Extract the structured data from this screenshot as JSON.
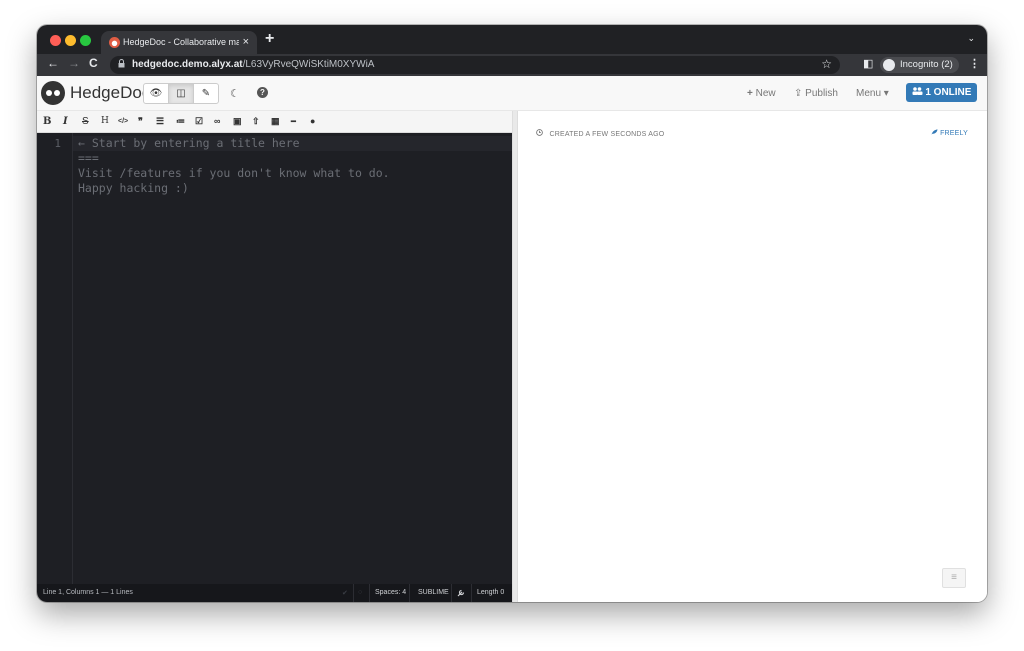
{
  "browser": {
    "tab_title": "HedgeDoc - Collaborative mar",
    "tab_close": "×",
    "new_tab": "+",
    "tabs_menu": "⌄",
    "back": "←",
    "forward": "→",
    "reload": "C",
    "lock": "🔒",
    "url_host": "hedgedoc.demo.alyx.at",
    "url_path": "/L63VyRveQWiSKtiM0XYWiA",
    "bookmark": "☆",
    "sidepanel": "◧",
    "incognito_label": "Incognito (2)",
    "more": "⋮"
  },
  "navbar": {
    "brand": "HedgeDoc",
    "modes": [
      {
        "name": "view",
        "icon": "👁"
      },
      {
        "name": "both",
        "icon": "◫"
      },
      {
        "name": "edit",
        "icon": "✎"
      }
    ],
    "night_icon": "☾",
    "help_icon": "?",
    "new_label": "New",
    "new_icon": "+",
    "publish_label": "Publish",
    "publish_icon": "⇪",
    "menu_label": "Menu",
    "menu_caret": "▾",
    "online_icon": "👥",
    "online_label": "1 ONLINE"
  },
  "editor_toolbar": {
    "bold": "B",
    "italic": "I",
    "strike": "S",
    "heading": "H",
    "code": "</>",
    "quote": "❞",
    "ul": "☰",
    "ol": "≔",
    "check": "☑",
    "link": "∞",
    "image": "▣",
    "upload": "⇧",
    "table": "▦",
    "hr": "━",
    "comment": "●"
  },
  "editor": {
    "line_numbers": [
      "1"
    ],
    "lines": [
      "← Start by entering a title here",
      "===",
      "Visit /features if you don't know what to do.",
      "Happy hacking :)"
    ]
  },
  "statusbar": {
    "position": "Line 1, Columns 1 — 1 Lines",
    "spaces": "Spaces: 4",
    "keymap": "SUBLIME",
    "length": "Length 0"
  },
  "preview": {
    "created": "CREATED A FEW SECONDS AGO",
    "permission": "FREELY",
    "toc_icon": "≡"
  },
  "colors": {
    "accent": "#337ab7",
    "editor_bg": "#1e1f24",
    "chrome_dark": "#202124"
  }
}
